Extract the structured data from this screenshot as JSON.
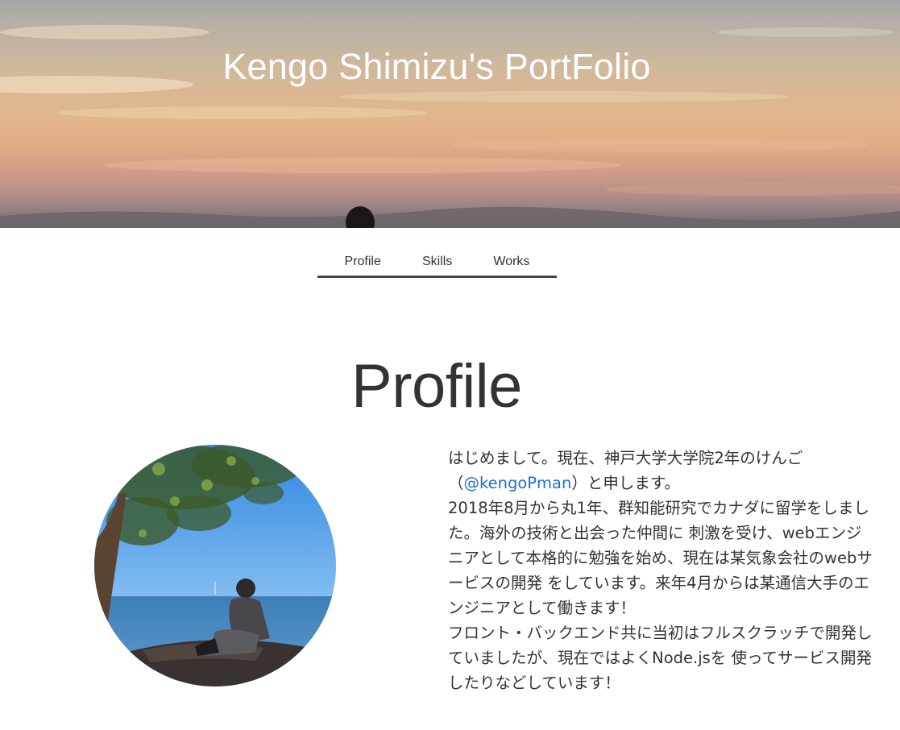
{
  "header": {
    "title": "Kengo Shimizu's PortFolio"
  },
  "nav": {
    "tabs": [
      {
        "label": "Profile"
      },
      {
        "label": "Skills"
      },
      {
        "label": "Works"
      }
    ]
  },
  "profile": {
    "heading": "Profile",
    "bio": {
      "line1": "はじめまして。現在、神戸大学大学院2年のけんご",
      "line2_open": "（",
      "handle": "@kengoPman",
      "line2_close": "）と申します。",
      "paragraph2": "2018年8月から丸1年、群知能研究でカナダに留学をしました。海外の技術と出会った仲間に 刺激を受け、webエンジニアとして本格的に勉強を始め、現在は某気象会社のwebサービスの開発 をしています。来年4月からは某通信大手のエンジニアとして働きます！",
      "paragraph3": "フロント・バックエンド共に当初はフルスクラッチで開発していましたが、現在ではよくNode.jsを 使ってサービス開発したりなどしています！"
    }
  },
  "colors": {
    "link": "#1a6fd0",
    "text": "#333333",
    "nav_underline": "#444444"
  }
}
